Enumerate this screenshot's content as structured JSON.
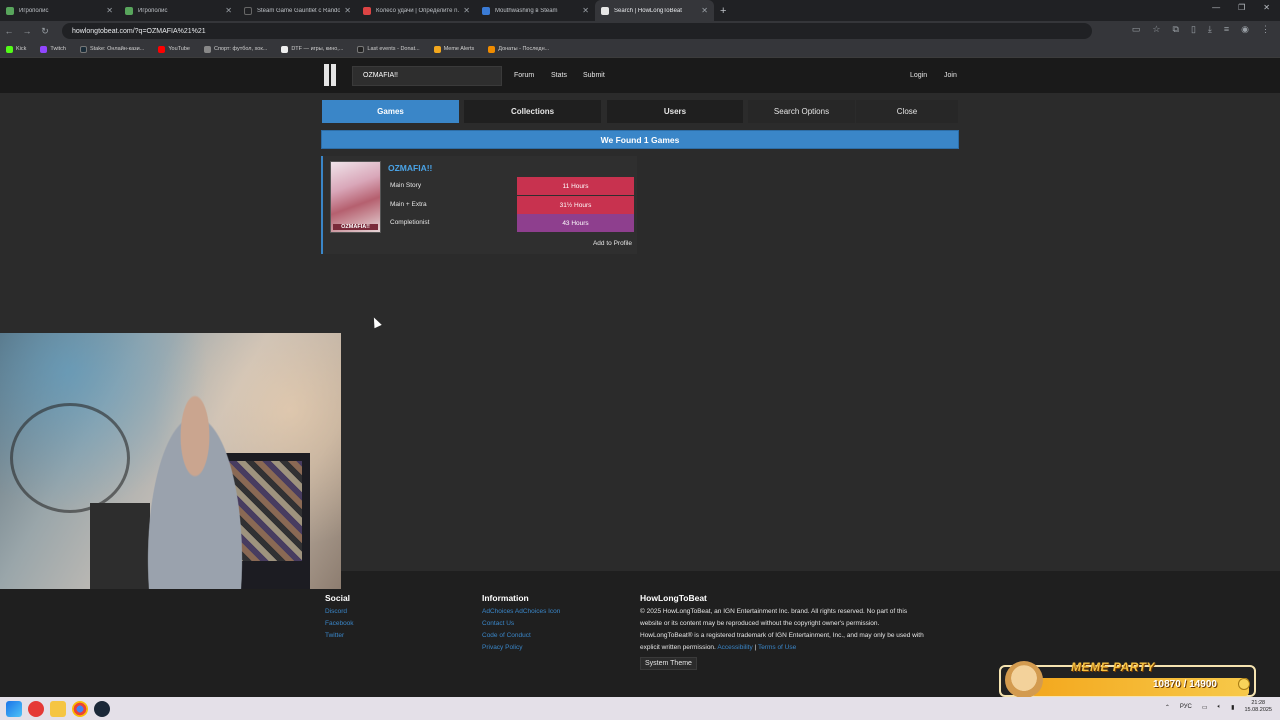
{
  "browser": {
    "tabs": [
      {
        "label": "Игрополис",
        "color": "#58a55c",
        "active": false
      },
      {
        "label": "Игрополис",
        "color": "#58a55c",
        "active": false
      },
      {
        "label": "Steam Game Gauntlet с Random...",
        "color": "#202124",
        "active": false
      },
      {
        "label": "Колесо удачи | Определите n...",
        "color": "#d44",
        "active": false
      },
      {
        "label": "Mouthwashing в Steam",
        "color": "#3a7bd5",
        "active": false
      },
      {
        "label": "Search | HowLongToBeat",
        "color": "#333",
        "active": true
      }
    ],
    "new_tab_icon": "+",
    "url": "howlongtobeat.com/?q=OZMAFIA%21%21",
    "bookmarks": [
      {
        "label": "Kick",
        "color": "#53fc18"
      },
      {
        "label": "Twitch",
        "color": "#9146ff"
      },
      {
        "label": "Stake: Онлайн-кази...",
        "color": "#1a2c38"
      },
      {
        "label": "YouTube",
        "color": "#ff0000"
      },
      {
        "label": "Спорт: футбол, хок...",
        "color": "#888"
      },
      {
        "label": "DTF — игры, кино,...",
        "color": "#eee"
      },
      {
        "label": "Last events - Donat...",
        "color": "#222"
      },
      {
        "label": "Meme Alerts",
        "color": "#f3a81e"
      },
      {
        "label": "Донаты - Последн...",
        "color": "#f08c00"
      }
    ]
  },
  "header": {
    "search_value": "OZMAFIA!!",
    "nav": [
      "Forum",
      "Stats",
      "Submit"
    ],
    "login": "Login",
    "join": "Join"
  },
  "search_tabs": {
    "games": "Games",
    "collections": "Collections",
    "users": "Users",
    "options": "Search Options",
    "close": "Close"
  },
  "results": {
    "found_label": "We Found 1 Games",
    "game": {
      "title": "OZMAFIA!!",
      "cover_text": "OZMAFIA!!",
      "rows": [
        {
          "label": "Main Story",
          "time": "11 Hours",
          "color": "#c8324f"
        },
        {
          "label": "Main + Extra",
          "time": "31½ Hours",
          "color": "#c8324f"
        },
        {
          "label": "Completionist",
          "time": "43 Hours",
          "color": "#8e3f8e"
        }
      ],
      "add_to_profile": "Add to Profile"
    }
  },
  "footer": {
    "social": {
      "heading": "Social",
      "links": [
        "Discord",
        "Facebook",
        "Twitter"
      ]
    },
    "information": {
      "heading": "Information",
      "adchoices": "AdChoices",
      "adchoices_icon_alt": "AdChoices Icon",
      "links": [
        "Contact Us",
        "Code of Conduct",
        "Privacy Policy"
      ]
    },
    "hltb": {
      "heading": "HowLongToBeat",
      "line1": "© 2025 HowLongToBeat, an IGN Entertainment Inc. brand. All rights reserved. No part of this",
      "line2": "website or its content may be reproduced without the copyright owner's permission.",
      "line3": "HowLongToBeat® is a registered trademark of IGN Entertainment, Inc., and may only be used with",
      "line4_prefix": "explicit written permission.",
      "accessibility": "Accessibility",
      "separator": "|",
      "terms": "Terms of Use",
      "theme": "System Theme"
    }
  },
  "meme_widget": {
    "title": "MEME PARTY",
    "count": "10870 / 14900"
  },
  "taskbar": {
    "lang": "РУС",
    "time": "21:28",
    "date": "15.08.2025"
  }
}
